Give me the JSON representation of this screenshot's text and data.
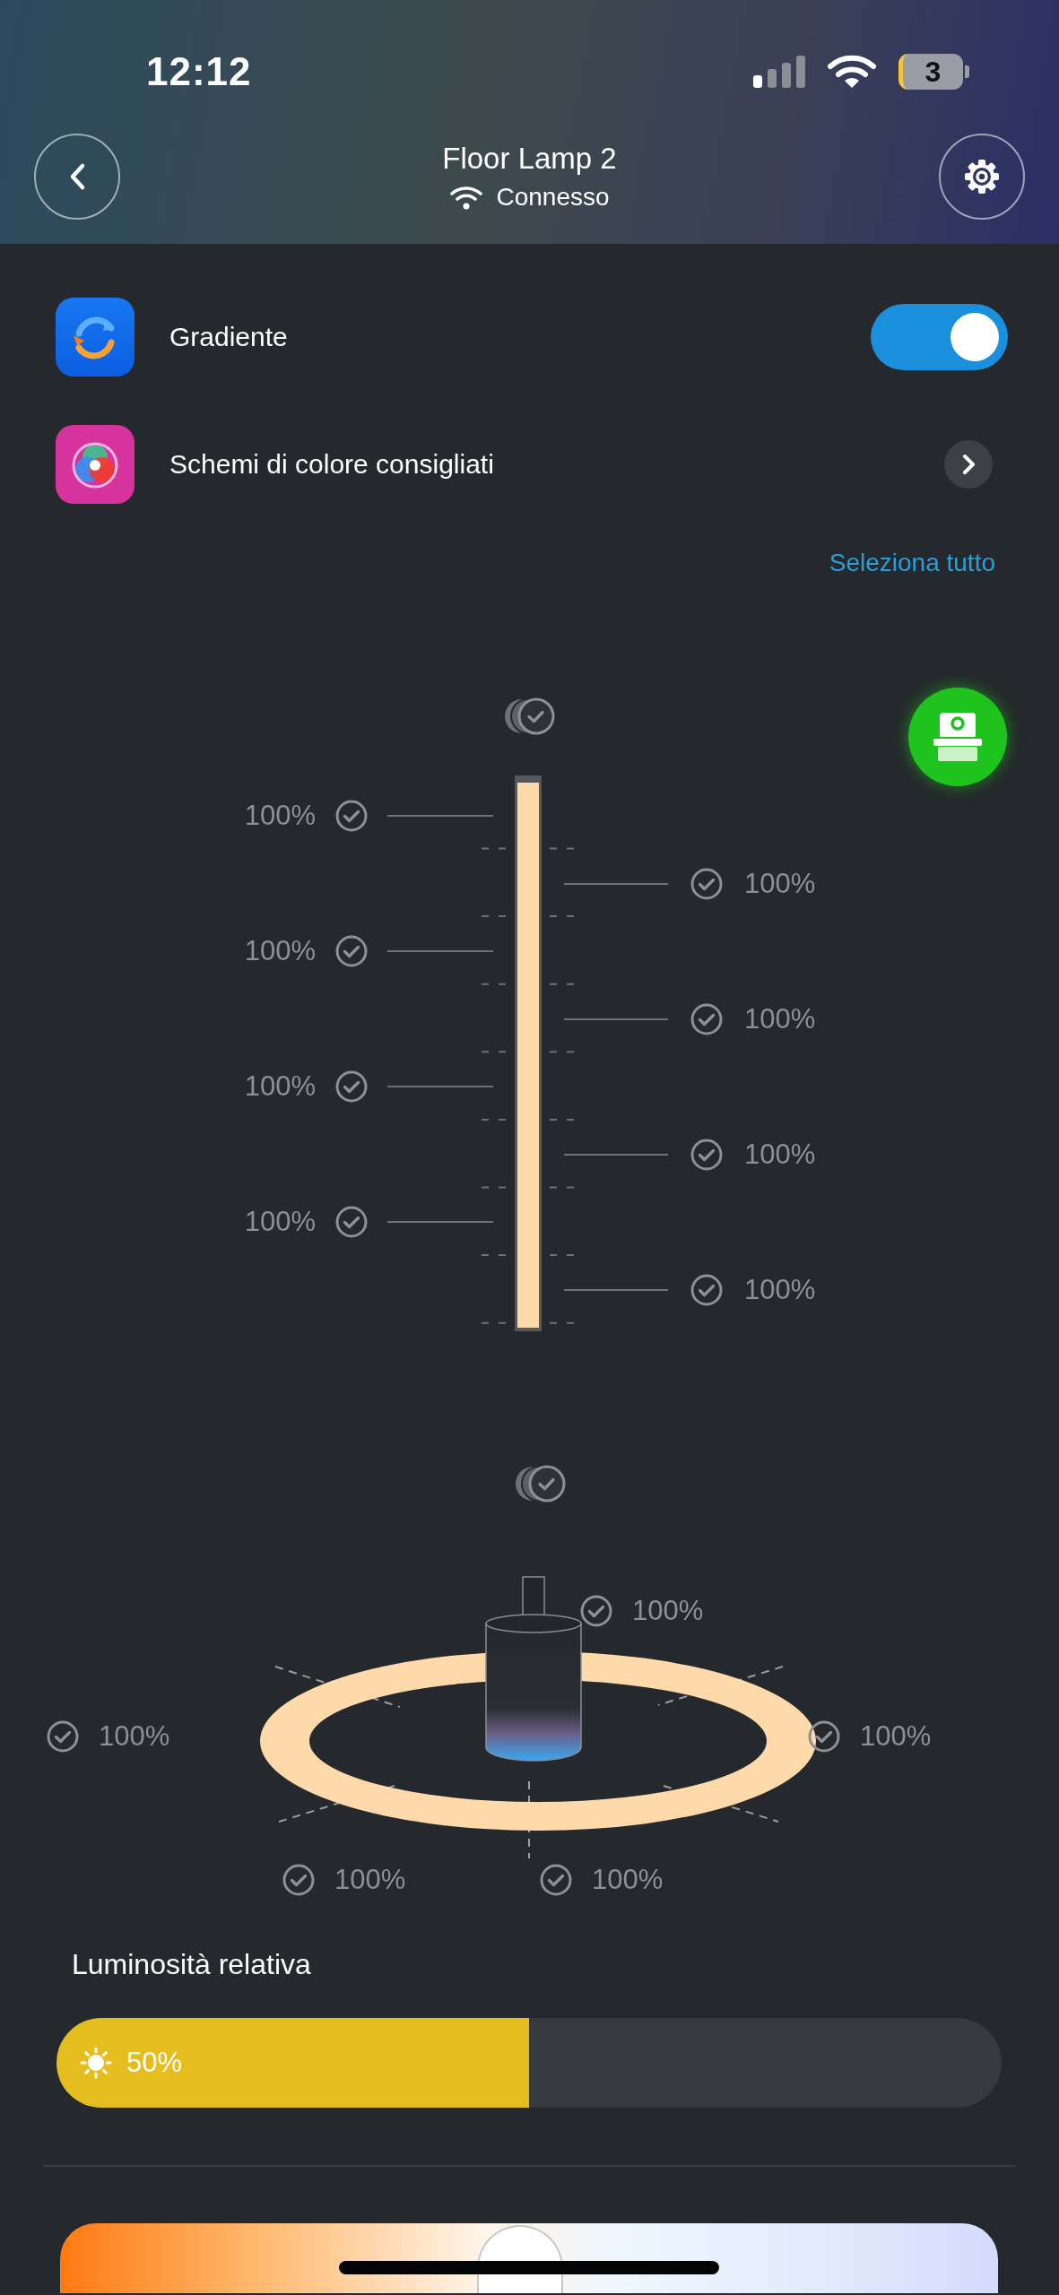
{
  "status_bar": {
    "time": "12:12",
    "battery": "3"
  },
  "header": {
    "title": "Floor Lamp 2",
    "connection": "Connesso"
  },
  "options": [
    {
      "kind": "toggle",
      "label": "Gradiente",
      "on": true
    },
    {
      "kind": "link",
      "label": "Schemi di colore consigliati"
    }
  ],
  "select_all": "Seleziona tutto",
  "strip": {
    "segments": [
      {
        "label": "100%",
        "checked": true
      },
      {
        "label": "100%",
        "checked": true
      },
      {
        "label": "100%",
        "checked": true
      },
      {
        "label": "100%",
        "checked": true
      },
      {
        "label": "100%",
        "checked": true
      },
      {
        "label": "100%",
        "checked": true
      },
      {
        "label": "100%",
        "checked": true
      },
      {
        "label": "100%",
        "checked": true
      }
    ]
  },
  "ring": {
    "segments": [
      {
        "kind": "top",
        "label": "100%",
        "checked": true
      },
      {
        "kind": "left",
        "label": "100%",
        "checked": true
      },
      {
        "kind": "right",
        "label": "100%",
        "checked": true
      },
      {
        "kind": "bottomleft",
        "label": "100%",
        "checked": true
      },
      {
        "kind": "bottom",
        "label": "100%",
        "checked": true
      }
    ]
  },
  "brightness": {
    "label": "Luminosità relativa",
    "level": 0.5,
    "reading": "50%"
  },
  "color_temperature": {
    "level": 0.49
  }
}
